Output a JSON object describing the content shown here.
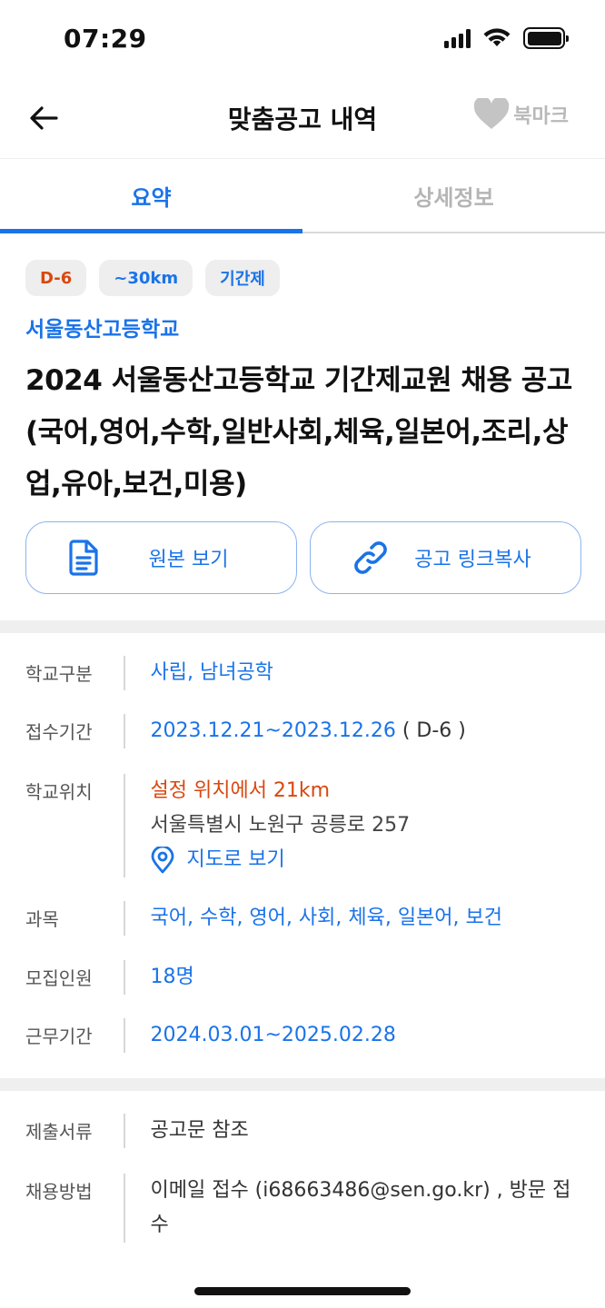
{
  "status_bar": {
    "time": "07:29"
  },
  "nav": {
    "title": "맞춤공고 내역",
    "bookmark_label": "북마크"
  },
  "tabs": [
    {
      "label": "요약",
      "active": true
    },
    {
      "label": "상세정보",
      "active": false
    }
  ],
  "summary": {
    "chips": [
      "D-6",
      "~30km",
      "기간제"
    ],
    "school_name": "서울동산고등학교",
    "title": "2024 서울동산고등학교 기간제교원 채용 공고(국어,영어,수학,일반사회,체육,일본어,조리,상업,유아,보건,미용)"
  },
  "actions": {
    "view_original": "원본 보기",
    "copy_link": "공고 링크복사"
  },
  "info": {
    "school_type": {
      "label": "학교구분",
      "value": "사립, 남녀공학"
    },
    "apply_period": {
      "label": "접수기간",
      "value": "2023.12.21~2023.12.26",
      "dday": " ( D-6 )"
    },
    "location": {
      "label": "학교위치",
      "distance": "설정 위치에서 21km",
      "address": "서울특별시 노원구 공릉로 257",
      "map_link": "지도로 보기"
    },
    "subjects": {
      "label": "과목",
      "value": "국어, 수학, 영어, 사회, 체육, 일본어, 보건"
    },
    "headcount": {
      "label": "모집인원",
      "value": "18명"
    },
    "work_period": {
      "label": "근무기간",
      "value": "2024.03.01~2025.02.28"
    },
    "documents": {
      "label": "제출서류",
      "value": "공고문 참조"
    },
    "method": {
      "label": "채용방법",
      "value": "이메일 접수 (i68663486@sen.go.kr) , 방문 접수"
    }
  },
  "colors": {
    "accent": "#1a73e8",
    "warning": "#d9480f"
  }
}
